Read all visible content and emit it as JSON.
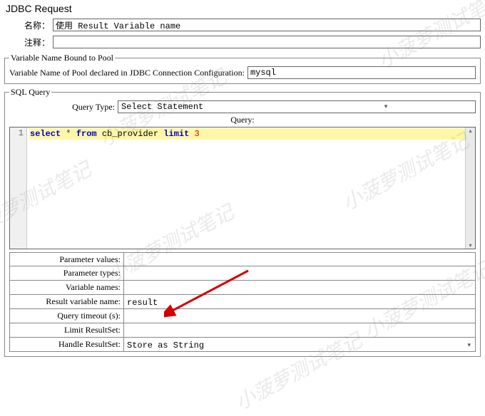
{
  "title": "JDBC Request",
  "topFields": {
    "nameLabel": "名称：",
    "nameValue": "使用 Result Variable name",
    "commentLabel": "注释：",
    "commentValue": ""
  },
  "poolGroup": {
    "legend": "Variable Name Bound to Pool",
    "label": "Variable Name of Pool declared in JDBC Connection Configuration:",
    "value": "mysql"
  },
  "sqlGroup": {
    "legend": "SQL Query",
    "queryTypeLabel": "Query Type:",
    "queryTypeValue": "Select Statement",
    "editorHeader": "Query:",
    "lineNumber": "1",
    "sql": {
      "select": "select",
      "star": "*",
      "from": "from",
      "table": "cb_provider",
      "limit": "limit",
      "num": "3"
    }
  },
  "params": {
    "paramValuesLabel": "Parameter values:",
    "paramValues": "",
    "paramTypesLabel": "Parameter types:",
    "paramTypes": "",
    "varNamesLabel": "Variable names:",
    "varNames": "",
    "resultVarLabel": "Result variable name:",
    "resultVar": "result",
    "timeoutLabel": "Query timeout (s):",
    "timeout": "",
    "limitRsLabel": "Limit ResultSet:",
    "limitRs": "",
    "handleRsLabel": "Handle ResultSet:",
    "handleRs": "Store as String"
  },
  "watermark": "小菠萝测试笔记"
}
